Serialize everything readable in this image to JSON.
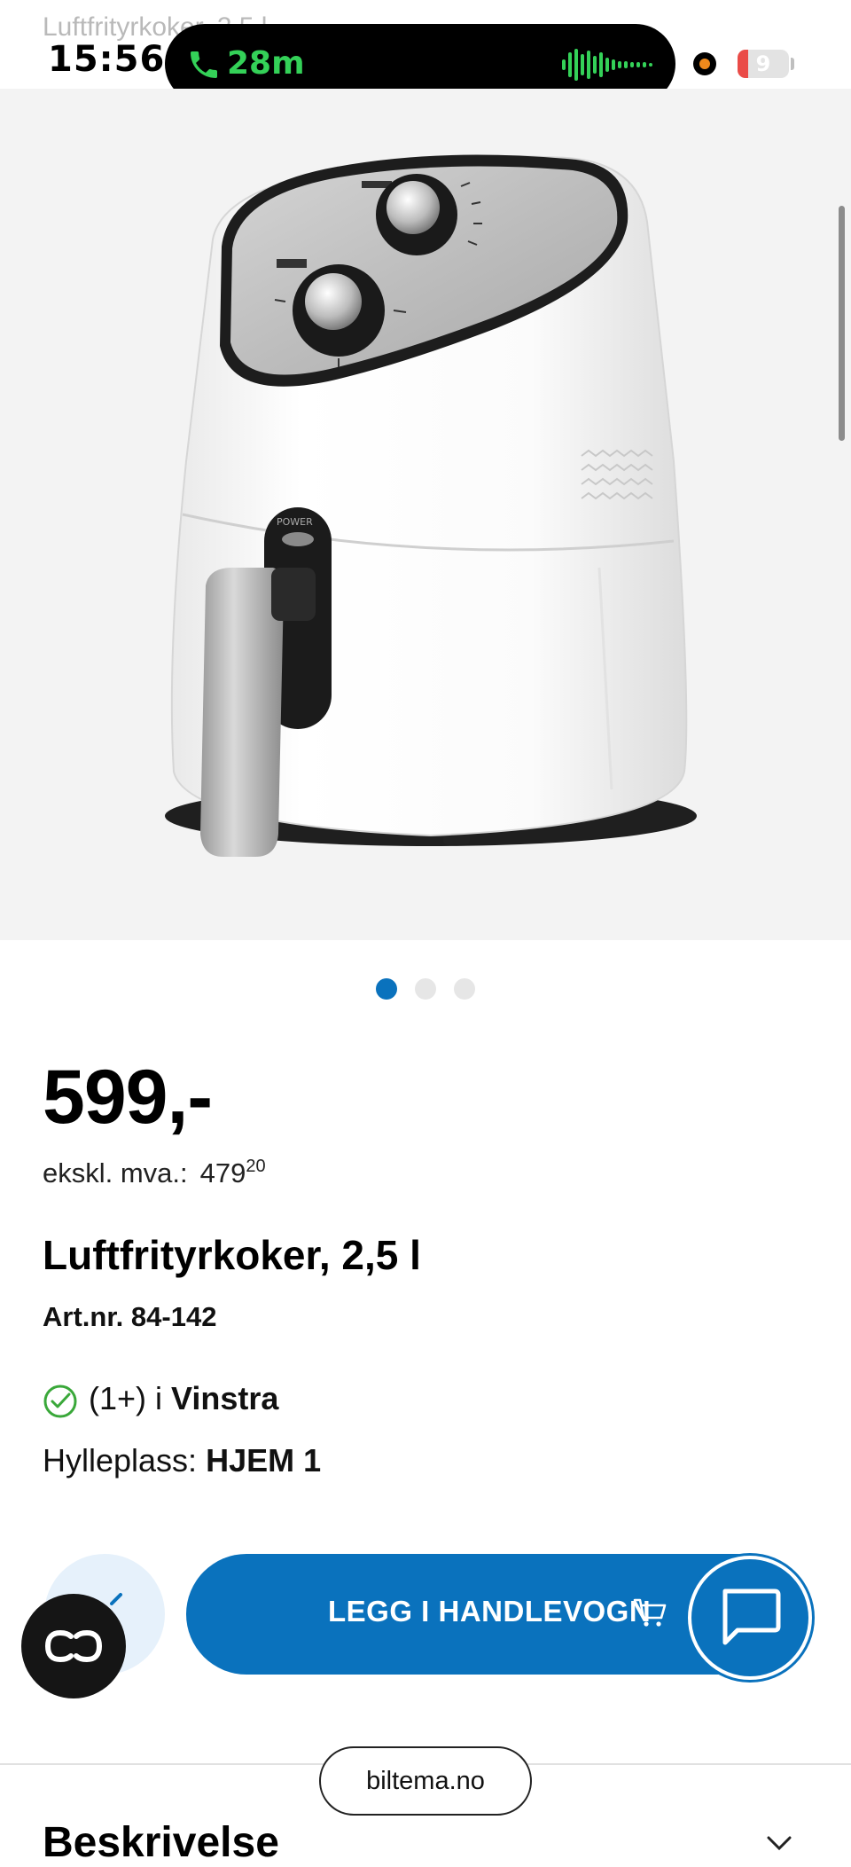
{
  "page": {
    "faded_title": "Luftfrityrkoker, 2,5 l",
    "url": "biltema.no"
  },
  "status_bar": {
    "time": "15:56",
    "call_duration": "28m",
    "battery_level": "9"
  },
  "gallery": {
    "image_name": "air-fryer-image",
    "active_index": 0,
    "count": 3
  },
  "product": {
    "price": "599,-",
    "ex_vat_label": "ekskl. mva.:",
    "ex_vat_integer": "479",
    "ex_vat_decimal": "20",
    "title": "Luftfrityrkoker, 2,5 l",
    "article_number": "Art.nr. 84-142",
    "stock_count": "(1+) i",
    "store_name": "Vinstra",
    "shelf_label": "Hylleplass:",
    "shelf_value": "HJEM 1"
  },
  "actions": {
    "add_to_cart": "LEGG I HANDLEVOGN"
  },
  "sections": {
    "description_heading": "Beskrivelse"
  },
  "colors": {
    "primary": "#0a72bd",
    "check": "#3aa83a",
    "call_green": "#34d158"
  }
}
